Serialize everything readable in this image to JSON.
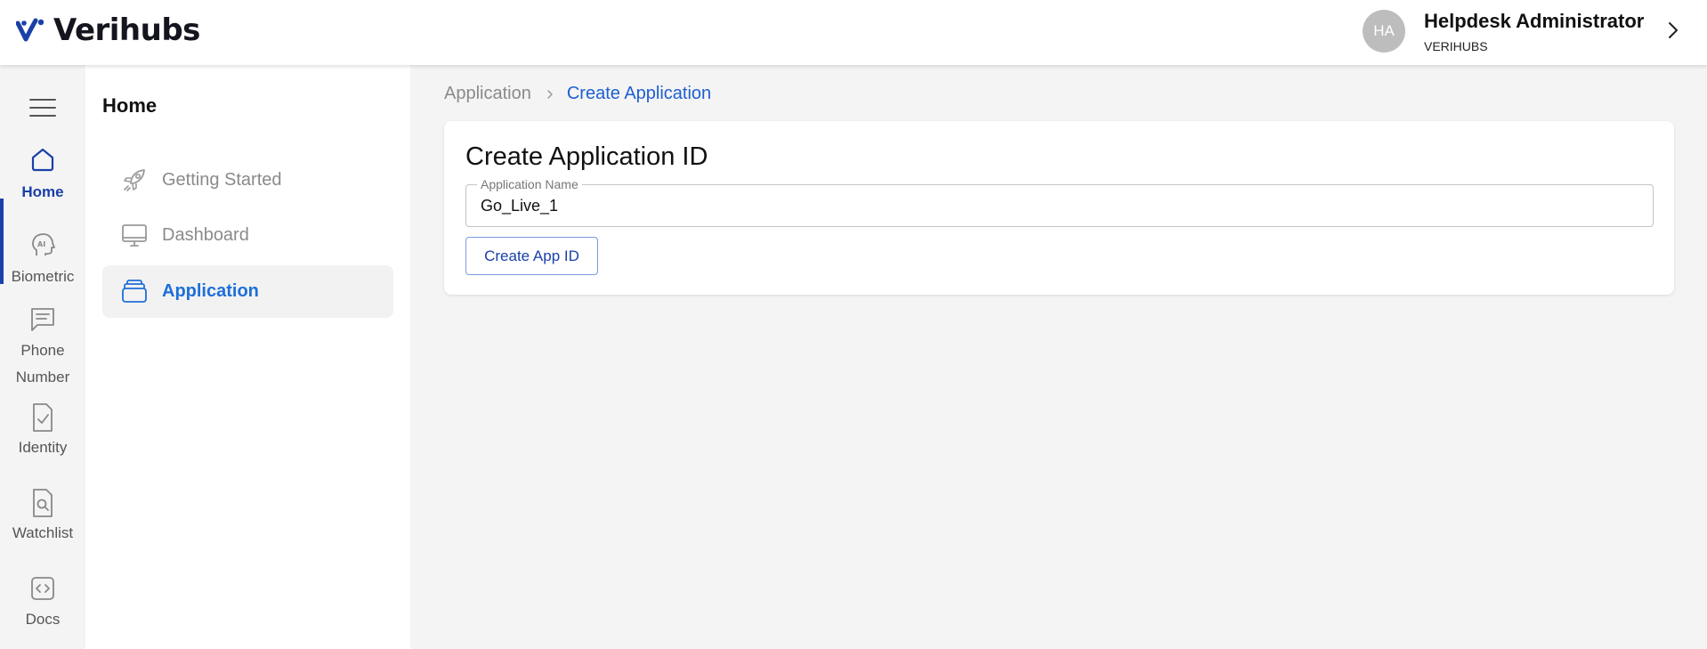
{
  "app": {
    "name": "Verihubs",
    "accent": "#1a40a8",
    "link_blue": "#1e5fd0"
  },
  "user": {
    "initials": "HA",
    "name": "Helpdesk Administrator",
    "org": "VERIHUBS"
  },
  "rail": [
    {
      "label": "Home",
      "icon": "home-icon",
      "active": true
    },
    {
      "label": "Biometric",
      "icon": "ai-head-icon"
    },
    {
      "label": "Phone Number",
      "icon": "message-icon"
    },
    {
      "label": "Identity",
      "icon": "document-check-icon"
    },
    {
      "label": "Watchlist",
      "icon": "document-search-icon"
    },
    {
      "label": "Docs",
      "icon": "code-icon"
    }
  ],
  "subnav": {
    "title": "Home",
    "items": [
      {
        "label": "Getting Started",
        "icon": "rocket-icon"
      },
      {
        "label": "Dashboard",
        "icon": "monitor-icon"
      },
      {
        "label": "Application",
        "icon": "layers-icon",
        "active": true
      }
    ]
  },
  "breadcrumb": {
    "parent": "Application",
    "current": "Create Application"
  },
  "form": {
    "title": "Create Application ID",
    "field_label": "Application Name",
    "field_value": "Go_Live_1",
    "submit_label": "Create App ID"
  }
}
